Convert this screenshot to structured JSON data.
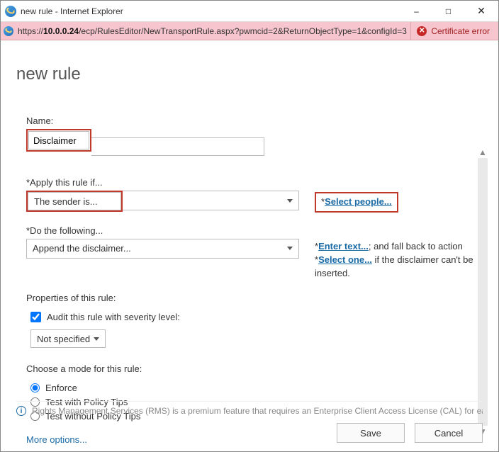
{
  "window": {
    "title": "new rule - Internet Explorer"
  },
  "addressbar": {
    "scheme": "https://",
    "host": "10.0.0.24",
    "path": "/ecp/RulesEditor/NewTransportRule.aspx?pwmcid=2&ReturnObjectType=1&configId=3",
    "cert_error": "Certificate error"
  },
  "page": {
    "heading": "new rule",
    "name_label": "Name:",
    "name_value": "Disclaimer",
    "apply_label": "*Apply this rule if...",
    "apply_value": "The sender is...",
    "select_people_link": "Select people...",
    "do_label": "*Do the following...",
    "do_value": "Append the disclaimer...",
    "enter_text_link": "Enter text...",
    "fallback_mid": "; and fall back to action *",
    "select_one_link": "Select one...",
    "fallback_tail": " if the disclaimer can't be inserted.",
    "props_header": "Properties of this rule:",
    "audit_label": "Audit this rule with severity level:",
    "audit_checked": true,
    "severity_value": "Not specified",
    "mode_header": "Choose a mode for this rule:",
    "modes": [
      {
        "label": "Enforce",
        "checked": true
      },
      {
        "label": "Test with Policy Tips",
        "checked": false
      },
      {
        "label": "Test without Policy Tips",
        "checked": false
      }
    ],
    "more_options": "More options...",
    "footer_note": "Rights Management Services (RMS) is a premium feature that requires an Enterprise Client Access License (CAL) for each",
    "save_btn": "Save",
    "cancel_btn": "Cancel"
  }
}
